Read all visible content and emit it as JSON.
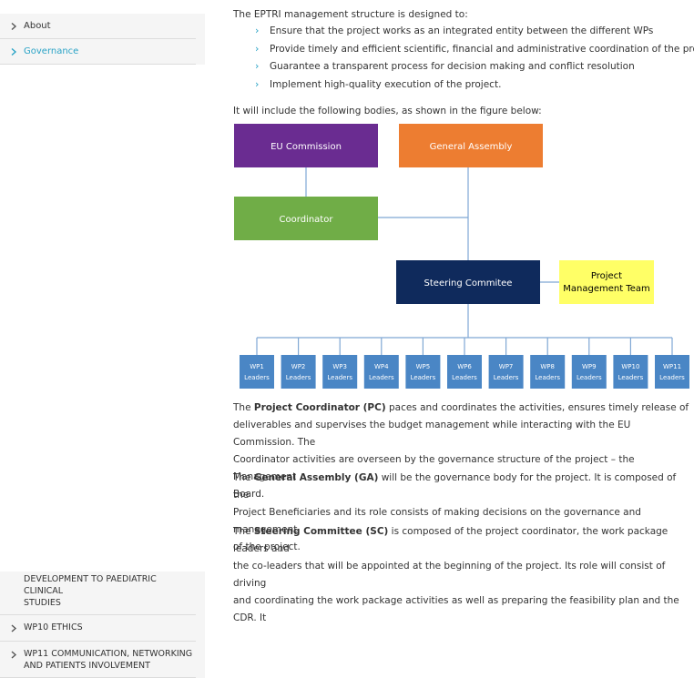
{
  "sidebar_top": {
    "items": [
      {
        "label": "About",
        "active": false
      },
      {
        "label": "Governance",
        "active": true
      }
    ]
  },
  "sidebar_bottom": {
    "items": [
      {
        "label_line1": "DEVELOPMENT TO PAEDIATRIC CLINICAL",
        "label_line2": "STUDIES"
      },
      {
        "label_line1": "WP10 ETHICS",
        "label_line2": ""
      },
      {
        "label_line1": "WP11 COMMUNICATION, NETWORKING",
        "label_line2": "AND PATIENTS INVOLVEMENT"
      }
    ]
  },
  "main": {
    "intro": "The EPTRI management structure is designed to:",
    "bullets": [
      "Ensure that the project works as an integrated entity between the different WPs",
      "Provide timely and efficient scientific, financial and administrative coordination of the project",
      "Guarantee a transparent process for decision making and conflict resolution",
      "Implement high-quality execution of the project."
    ],
    "include": "It will include the following bodies, as shown in the figure below:",
    "diagram": {
      "eu_commission": "EU Commission",
      "general_assembly": "General Assembly",
      "coordinator": "Coordinator",
      "steering_committee": "Steering Commitee",
      "pmt_line1": "Project",
      "pmt_line2": "Management Team",
      "wp_leaders_label": "Leaders",
      "wps": [
        "WP1",
        "WP2",
        "WP3",
        "WP4",
        "WP5",
        "WP6",
        "WP7",
        "WP8",
        "WP9",
        "WP10",
        "WP11"
      ],
      "colors": {
        "eu_commission": "#6a2c91",
        "general_assembly": "#ed7d31",
        "coordinator": "#70ad47",
        "steering_committee": "#0f2a5c",
        "pmt": "#ffff66",
        "wp": "#4a86c5",
        "connector": "#7fa7d4"
      }
    },
    "p1": {
      "lead": "The ",
      "bold": "Project Coordinator (PC)",
      "line1_rest": " paces and coordinates the activities, ensures timely release of",
      "line2": "deliverables and supervises the budget management while interacting with the EU Commission. The",
      "line3": "Coordinator activities are overseen by the governance structure of the project – the Management",
      "line4": "Board."
    },
    "p2": {
      "lead": "The ",
      "bold": "General Assembly (GA)",
      "line1_rest": " will be the governance body for the project. It is composed of the",
      "line2": "Project Beneficiaries and its role consists of making decisions on the governance and management",
      "line3": "of the project."
    },
    "p3": {
      "lead": "The ",
      "bold": "Steering Committee (SC)",
      "line1_rest": " is composed of the project coordinator, the work package leaders and",
      "line2": "the co-leaders that will be appointed at the beginning of the project. Its role will consist of driving",
      "line3": "and coordinating the work package activities as well as preparing the feasibility plan and the CDR. It"
    }
  }
}
